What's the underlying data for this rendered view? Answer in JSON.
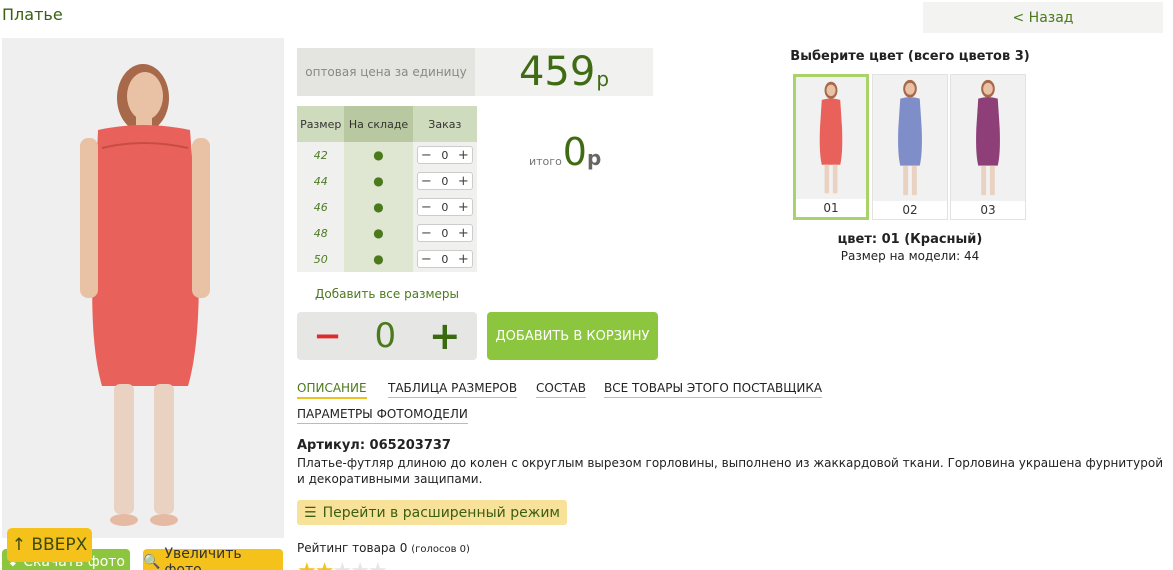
{
  "page": {
    "title": "Платье",
    "back_label": "< Назад"
  },
  "photo": {
    "alt": "Платье"
  },
  "price": {
    "label": "оптовая цена за единицу",
    "value": "459",
    "currency": "р"
  },
  "sizes_table": {
    "headers": {
      "size": "Размер",
      "stock": "На складе",
      "order": "Заказ"
    },
    "rows": [
      {
        "size": "42",
        "stock": "●",
        "qty": "0"
      },
      {
        "size": "44",
        "stock": "●",
        "qty": "0"
      },
      {
        "size": "46",
        "stock": "●",
        "qty": "0"
      },
      {
        "size": "48",
        "stock": "●",
        "qty": "0"
      },
      {
        "size": "50",
        "stock": "●",
        "qty": "0"
      }
    ],
    "minus": "−",
    "plus": "+"
  },
  "total": {
    "label": "итого",
    "value": "0",
    "currency": "р"
  },
  "add_all_sizes": "Добавить все размеры",
  "quantity": {
    "minus": "−",
    "value": "0",
    "plus": "+"
  },
  "add_to_cart": "ДОБАВИТЬ В КОРЗИНУ",
  "tabs": [
    {
      "label": "ОПИСАНИЕ",
      "active": true
    },
    {
      "label": "ТАБЛИЦА РАЗМЕРОВ",
      "active": false
    },
    {
      "label": "СОСТАВ",
      "active": false
    },
    {
      "label": "ВСЕ ТОВАРЫ ЭТОГО ПОСТАВЩИКА",
      "active": false
    },
    {
      "label": "ПАРАМЕТРЫ ФОТОМОДЕЛИ",
      "active": false
    }
  ],
  "article": "Артикул: 065203737",
  "description": "Платье-футляр длиною до колен с округлым вырезом горловины, выполнено из жаккардовой ткани. Горловина украшена фурнитурой и декоративными защипами.",
  "extended_mode": "Перейти в расширенный режим",
  "rating": {
    "label": "Рейтинг товара 0",
    "votes": "(голосов 0)"
  },
  "buttons": {
    "up": "ВВЕРХ",
    "download": "Скачать фото",
    "zoom": "Увеличить фото"
  },
  "colors": {
    "title": "Выберите цвет (всего цветов 3)",
    "items": [
      {
        "code": "01",
        "color": "#e8615a",
        "selected": true
      },
      {
        "code": "02",
        "color": "#7f8ec8",
        "selected": false
      },
      {
        "code": "03",
        "color": "#8e3f78",
        "selected": false
      }
    ],
    "selected_name": "цвет: 01 (Красный)",
    "model_size": "Размер на модели: 44"
  },
  "icons": {
    "up": "arrow-up-icon",
    "download": "download-icon",
    "zoom": "zoom-icon",
    "ext": "list-icon",
    "star": "star-icon"
  }
}
